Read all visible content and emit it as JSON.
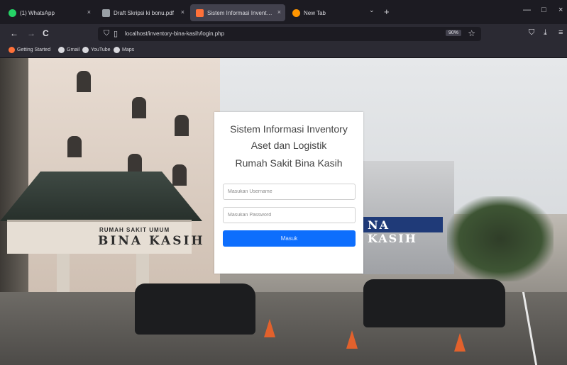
{
  "browser": {
    "tabs": [
      {
        "label": "(1) WhatsApp",
        "fav_color": "#25d366"
      },
      {
        "label": "Draft Skripsi ki bonu.pdf",
        "fav_color": "#9aa0a6"
      },
      {
        "label": "Sistem Informasi Inventory Aset &",
        "fav_color": "#ff7139"
      },
      {
        "label": "New Tab",
        "fav_color": "#ff9500"
      }
    ],
    "tab_close_glyph": "×",
    "new_tab_glyph": "+",
    "tab_list_glyph": "⌄",
    "window_controls": [
      "—",
      "□",
      "×"
    ],
    "nav": {
      "back": "←",
      "forward": "→",
      "reload": "C"
    },
    "url": "localhost/inventory-bina-kasih/login.php",
    "zoom": "90%",
    "bookmark_star": "☆",
    "toolbar_icons": [
      "⛉",
      "⤓",
      "≡"
    ],
    "bookmarks": [
      {
        "label": "Getting Started",
        "fav_color": "#ff7139"
      },
      {
        "label": "Gmail",
        "fav_color": "#d8d8dd"
      },
      {
        "label": "YouTube",
        "fav_color": "#d8d8dd"
      },
      {
        "label": "Maps",
        "fav_color": "#d8d8dd"
      }
    ]
  },
  "background": {
    "sign_small": "RUMAH SAKIT UMUM",
    "sign_main": "BINA KASIH",
    "blue_sign": "NA KASIH"
  },
  "login": {
    "title_line1": "Sistem Informasi Inventory",
    "title_line2": "Aset dan Logistik",
    "title_line3": "Rumah Sakit Bina Kasih",
    "username_placeholder": "Masukan Username",
    "password_placeholder": "Masukan Password",
    "submit_label": "Masuk",
    "accent_color": "#0d6efd"
  }
}
